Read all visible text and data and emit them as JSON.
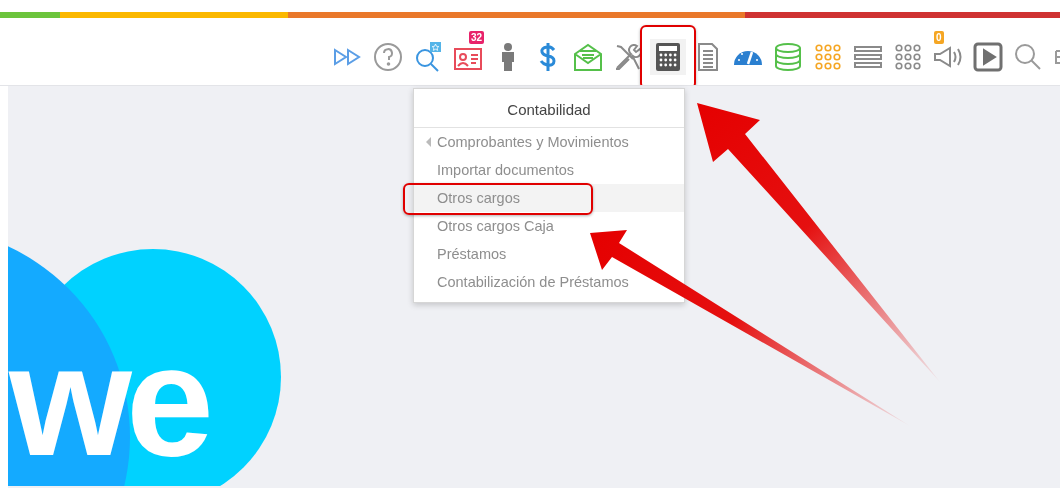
{
  "color_bar": [
    {
      "color": "#6cc43c"
    },
    {
      "color": "#fbb800"
    },
    {
      "color": "#e9782a"
    },
    {
      "color": "#cf3232"
    }
  ],
  "toolbar": [
    {
      "kind": "fast-forward",
      "color": "#5b9ee6",
      "selected": false
    },
    {
      "kind": "help",
      "color": "#9a9a9a",
      "selected": false
    },
    {
      "kind": "search-star",
      "color": "#3a95e0",
      "selected": false
    },
    {
      "kind": "contact-card",
      "color": "#e84b5a",
      "badge": "32",
      "selected": false
    },
    {
      "kind": "person",
      "color": "#7a7a7a",
      "selected": false
    },
    {
      "kind": "dollar",
      "color": "#2a8ad8",
      "selected": false
    },
    {
      "kind": "mail",
      "color": "#55c04a",
      "selected": false
    },
    {
      "kind": "tools",
      "color": "#8a8a8a",
      "selected": false
    },
    {
      "kind": "calculator",
      "color": "#555555",
      "selected": true
    },
    {
      "kind": "document",
      "color": "#8a8a8a",
      "selected": false
    },
    {
      "kind": "gauge",
      "color": "#2a7fd0",
      "selected": false
    },
    {
      "kind": "database",
      "color": "#55c04a",
      "selected": false
    },
    {
      "kind": "dots-grid",
      "color": "#f5a623",
      "selected": false
    },
    {
      "kind": "list",
      "color": "#8a8a8a",
      "selected": false
    },
    {
      "kind": "dots-grid",
      "color": "#8a8a8a",
      "selected": false
    },
    {
      "kind": "megaphone",
      "color": "#8a8a8a",
      "badge": "0",
      "selected": false
    },
    {
      "kind": "play",
      "color": "#707070",
      "selected": false
    },
    {
      "kind": "search",
      "color": "#9a9a9a",
      "selected": false
    },
    {
      "kind": "split",
      "color": "#9a9a9a",
      "selected": false
    }
  ],
  "menu": {
    "title": "Contabilidad",
    "items": [
      {
        "label": "Comprobantes y Movimientos",
        "has_submenu": true,
        "selected": false
      },
      {
        "label": "Importar documentos",
        "has_submenu": false,
        "selected": false
      },
      {
        "label": "Otros cargos",
        "has_submenu": false,
        "selected": true
      },
      {
        "label": "Otros cargos Caja",
        "has_submenu": false,
        "selected": false
      },
      {
        "label": "Préstamos",
        "has_submenu": false,
        "selected": false
      },
      {
        "label": "Contabilización de Préstamos",
        "has_submenu": false,
        "selected": false
      }
    ]
  },
  "logo": {
    "text": "we"
  }
}
